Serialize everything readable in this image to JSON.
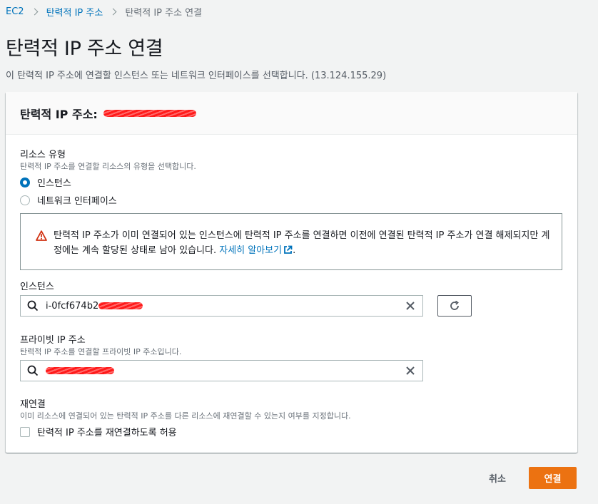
{
  "breadcrumb": {
    "root": "EC2",
    "parent": "탄력적 IP 주소",
    "current": "탄력적 IP 주소 연결"
  },
  "page": {
    "title": "탄력적 IP 주소 연결",
    "description": "이 탄력적 IP 주소에 연결할 인스턴스 또는 네트워크 인터페이스를 선택합니다. (13.124.155.29)"
  },
  "panel": {
    "header_label": "탄력적 IP 주소:",
    "resource_type": {
      "label": "리소스 유형",
      "description": "탄력적 IP 주소를 연결할 리소스의 유형을 선택합니다.",
      "options": [
        {
          "label": "인스턴스",
          "selected": true
        },
        {
          "label": "네트워크 인터페이스",
          "selected": false
        }
      ]
    },
    "alert": {
      "text": "탄력적 IP 주소가 이미 연결되어 있는 인스턴스에 탄력적 IP 주소를 연결하면 이전에 연결된 탄력적 IP 주소가 연결 해제되지만 계정에는 계속 할당된 상태로 남아 있습니다. ",
      "link": "자세히 알아보기",
      "tail": "."
    },
    "instance": {
      "label": "인스턴스",
      "value": "i-0fcf674b2"
    },
    "private_ip": {
      "label": "프라이빗 IP 주소",
      "description": "탄력적 IP 주소를 연결할 프라이빗 IP 주소입니다."
    },
    "reassociation": {
      "label": "재연결",
      "description": "이미 리소스에 연결되어 있는 탄력적 IP 주소를 다른 리소스에 재연결할 수 있는지 여부를 지정합니다.",
      "checkbox_label": "탄력적 IP 주소를 재연결하도록 허용",
      "checked": false
    }
  },
  "actions": {
    "cancel": "취소",
    "connect": "연결"
  },
  "colors": {
    "link": "#0073bb",
    "primary": "#ec7211",
    "warning": "#d13212"
  }
}
